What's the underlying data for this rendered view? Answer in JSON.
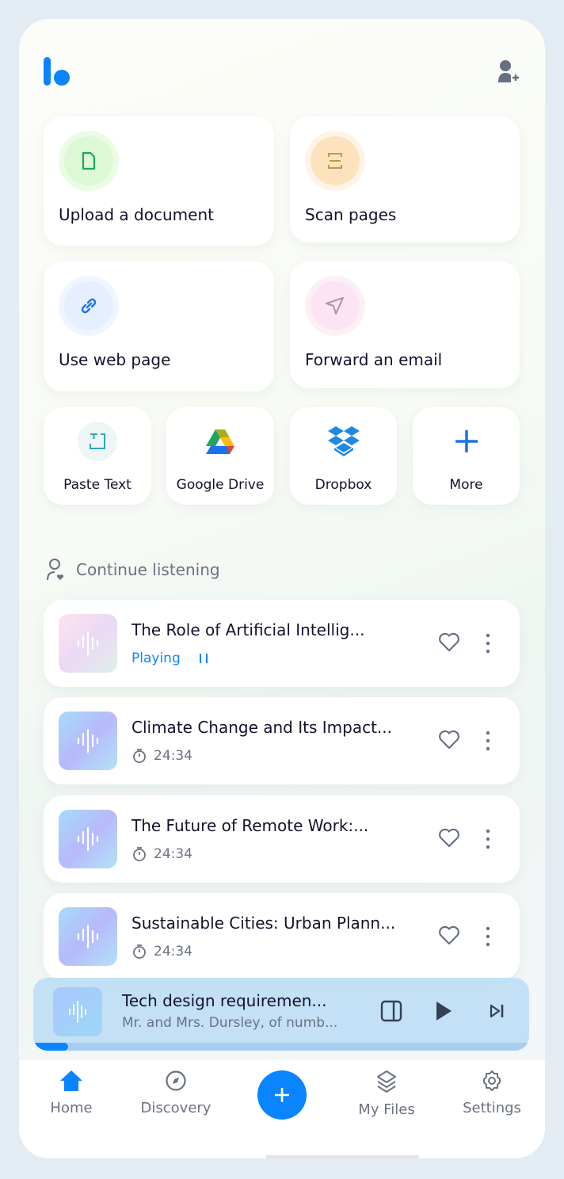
{
  "colors": {
    "accent": "#0a84ff",
    "text": "#14122b",
    "muted": "#6b7280"
  },
  "header": {
    "logo": "logo",
    "add_user_icon": "user-plus-icon"
  },
  "actions": [
    {
      "label": "Upload a document",
      "icon": "file-icon",
      "ring": "#eafbe6",
      "fill": "#dcf8d4",
      "color": "#1fa463"
    },
    {
      "label": "Scan pages",
      "icon": "scan-icon",
      "ring": "#fdf3e8",
      "fill": "#fde3bd",
      "color": "#c89550"
    },
    {
      "label": "Use web page",
      "icon": "link-icon",
      "ring": "#f0f5ff",
      "fill": "#e6efff",
      "color": "#1a73e8"
    },
    {
      "label": "Forward an email",
      "icon": "send-icon",
      "ring": "#fcf0f7",
      "fill": "#fbe4f3",
      "color": "#b88bb0"
    }
  ],
  "sources": [
    {
      "label": "Paste Text",
      "icon": "paste-text-icon"
    },
    {
      "label": "Google Drive",
      "icon": "google-drive-icon"
    },
    {
      "label": "Dropbox",
      "icon": "dropbox-icon"
    },
    {
      "label": "More",
      "icon": "plus-icon"
    }
  ],
  "continue": {
    "title": "Continue listening"
  },
  "items": [
    {
      "title": "The Role of Artificial Intellig...",
      "status": "Playing",
      "playing": true
    },
    {
      "title": "Climate Change and Its Impact...",
      "duration": "24:34"
    },
    {
      "title": "The Future of Remote Work:...",
      "duration": "24:34"
    },
    {
      "title": "Sustainable Cities: Urban Plann...",
      "duration": "24:34"
    }
  ],
  "player": {
    "title": "Tech design requiremen...",
    "subtitle": "Mr. and Mrs. Dursley, of numb...",
    "progress": 0.07
  },
  "nav": [
    {
      "label": "Home",
      "icon": "home-icon",
      "active": true
    },
    {
      "label": "Discovery",
      "icon": "compass-icon"
    },
    {
      "label": "My Files",
      "icon": "layers-icon"
    },
    {
      "label": "Settings",
      "icon": "gear-icon"
    }
  ]
}
